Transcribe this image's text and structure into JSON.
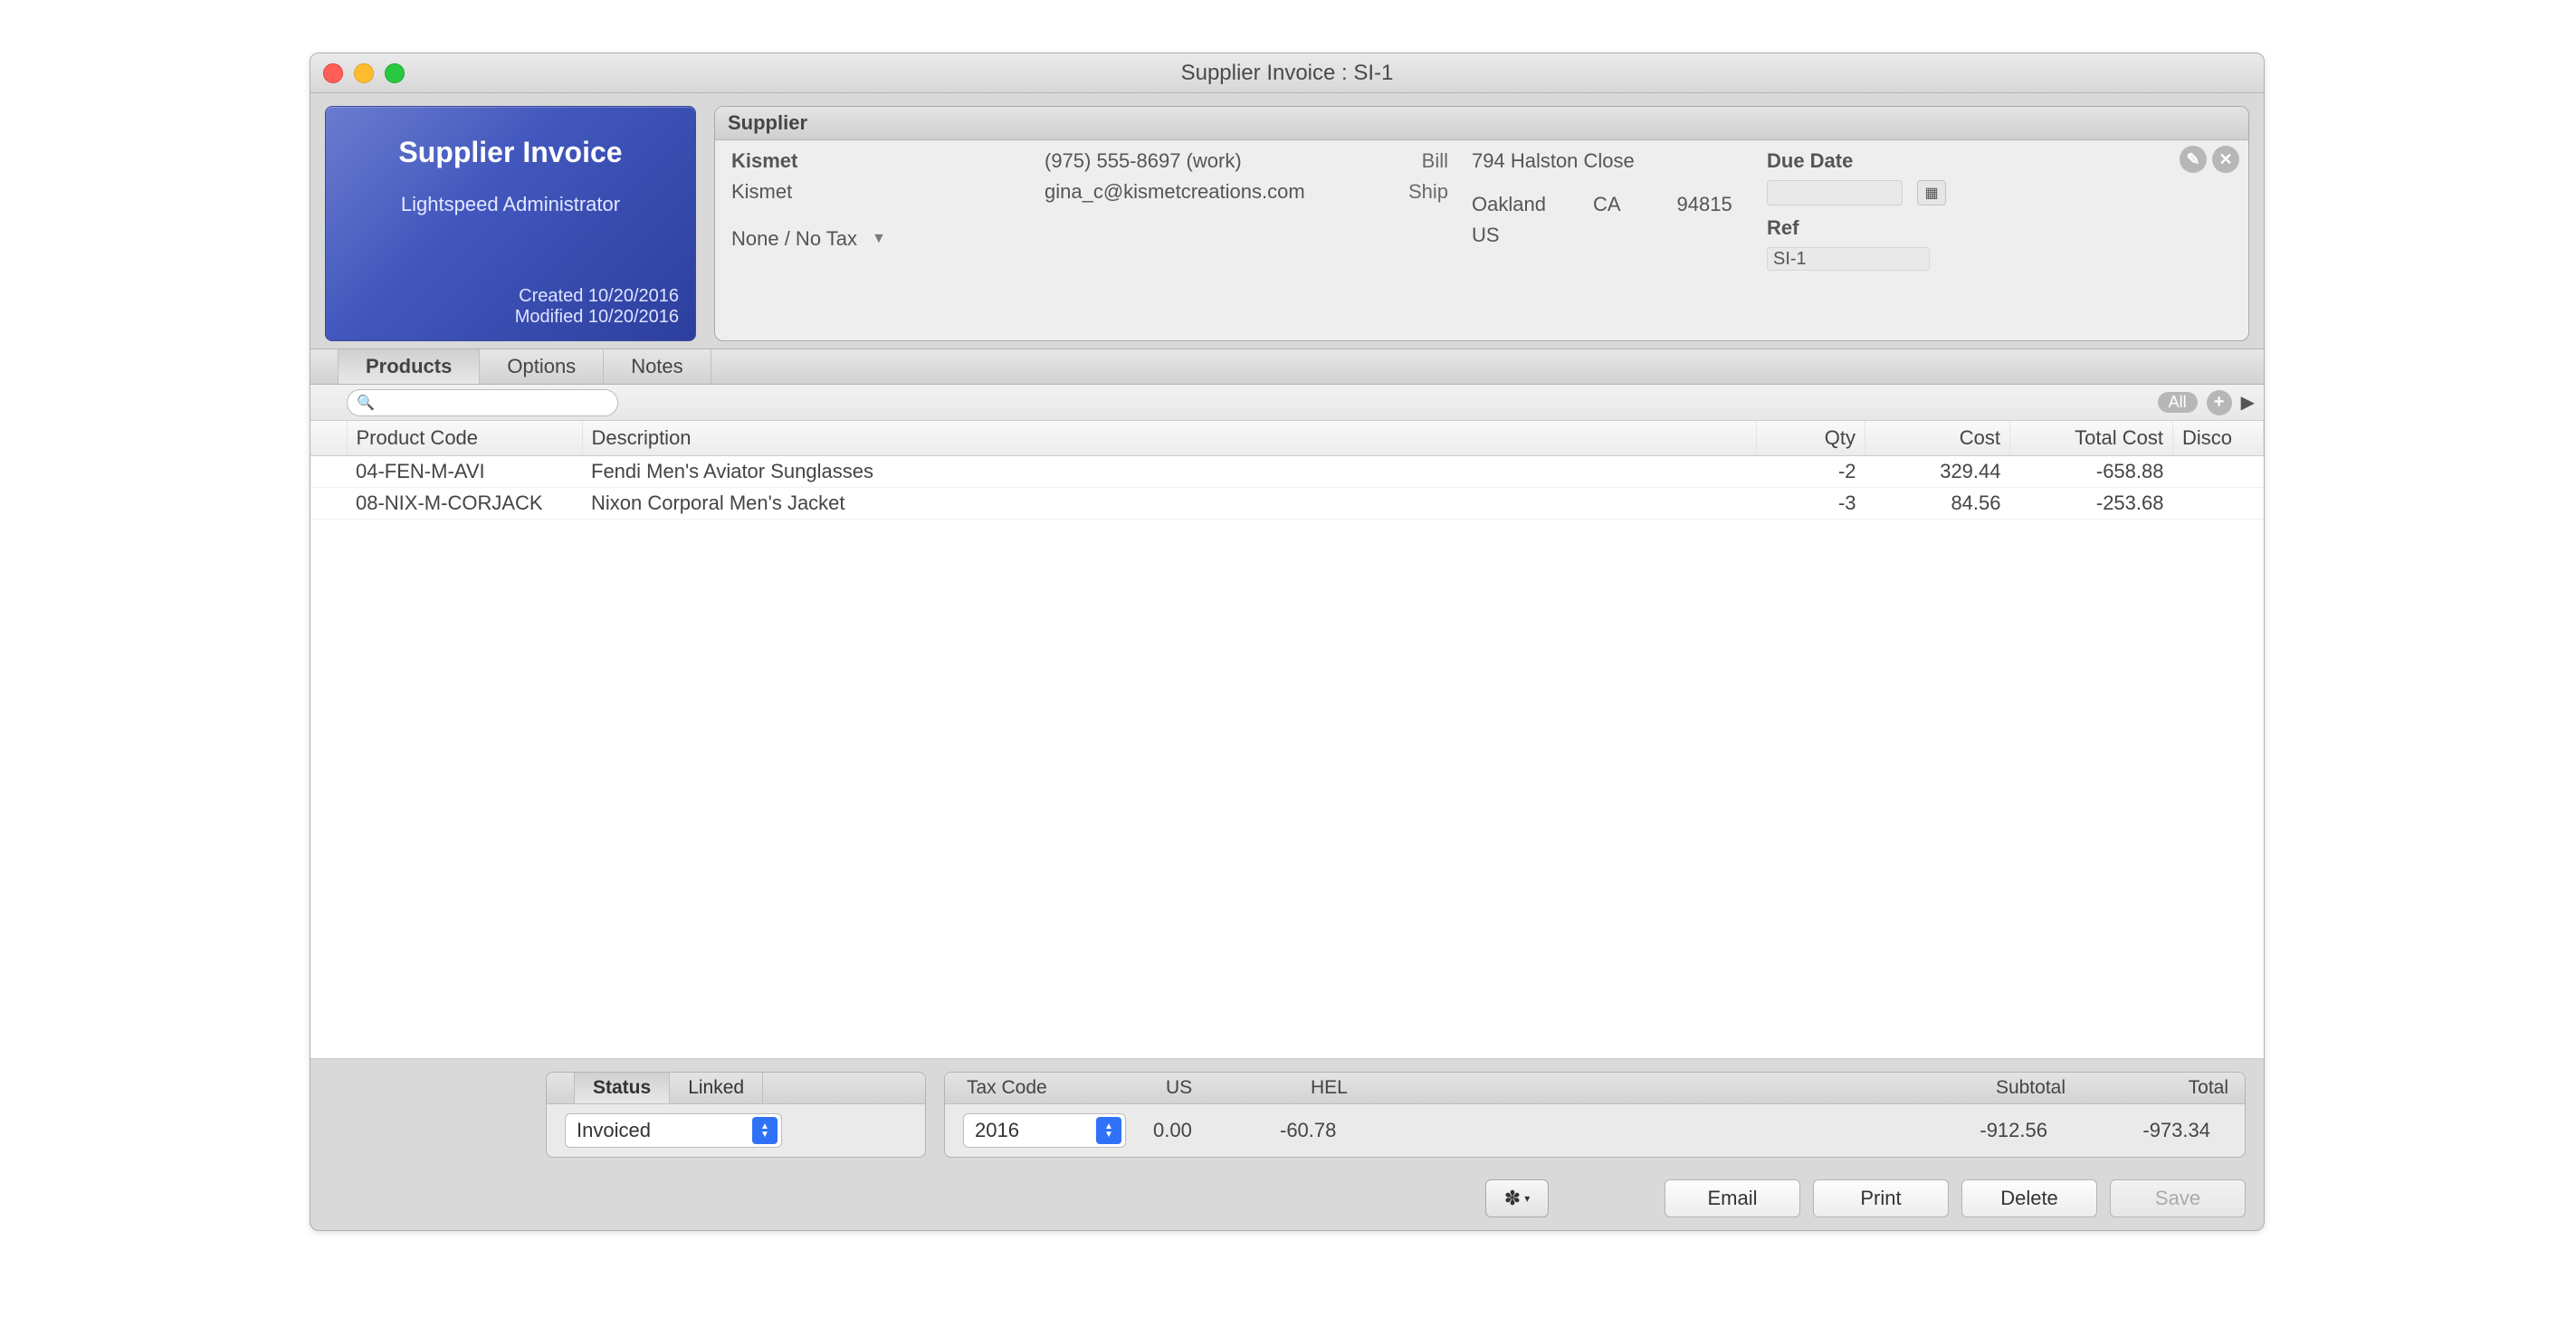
{
  "window_title": "Supplier Invoice : SI-1",
  "badge": {
    "title": "Supplier Invoice",
    "user": "Lightspeed Administrator",
    "created_label": "Created",
    "created_date": "10/20/2016",
    "modified_label": "Modified",
    "modified_date": "10/20/2016"
  },
  "supplier": {
    "section_label": "Supplier",
    "name_line1": "Kismet",
    "name_line2": "Kismet",
    "tax_line": "None / No Tax",
    "phone": "(975) 555-8697 (work)",
    "email": "gina_c@kismetcreations.com",
    "bill_label": "Bill",
    "ship_label": "Ship",
    "address_line1": "794 Halston Close",
    "city": "Oakland",
    "state": "CA",
    "zip": "94815",
    "country": "US",
    "due_label": "Due Date",
    "due_value": "",
    "ref_label": "Ref",
    "ref_value": "SI-1"
  },
  "tabs": {
    "products": "Products",
    "options": "Options",
    "notes": "Notes"
  },
  "search": {
    "placeholder": "",
    "all": "All"
  },
  "columns": {
    "code": "Product Code",
    "desc": "Description",
    "qty": "Qty",
    "cost": "Cost",
    "total": "Total Cost",
    "disc": "Disco"
  },
  "rows": [
    {
      "code": "04-FEN-M-AVI",
      "desc": "Fendi Men's Aviator Sunglasses",
      "qty": "-2",
      "cost": "329.44",
      "total": "-658.88",
      "disc": ""
    },
    {
      "code": "08-NIX-M-CORJACK",
      "desc": "Nixon Corporal Men's Jacket",
      "qty": "-3",
      "cost": "84.56",
      "total": "-253.68",
      "disc": ""
    }
  ],
  "status_panel": {
    "status_tab": "Status",
    "linked_tab": "Linked",
    "status_value": "Invoiced"
  },
  "totals_panel": {
    "taxcode_label": "Tax Code",
    "taxcode_value": "2016",
    "us_label": "US",
    "us_value": "0.00",
    "hel_label": "HEL",
    "hel_value": "-60.78",
    "subtotal_label": "Subtotal",
    "subtotal_value": "-912.56",
    "total_label": "Total",
    "total_value": "-973.34"
  },
  "buttons": {
    "email": "Email",
    "print": "Print",
    "delete": "Delete",
    "save": "Save"
  }
}
